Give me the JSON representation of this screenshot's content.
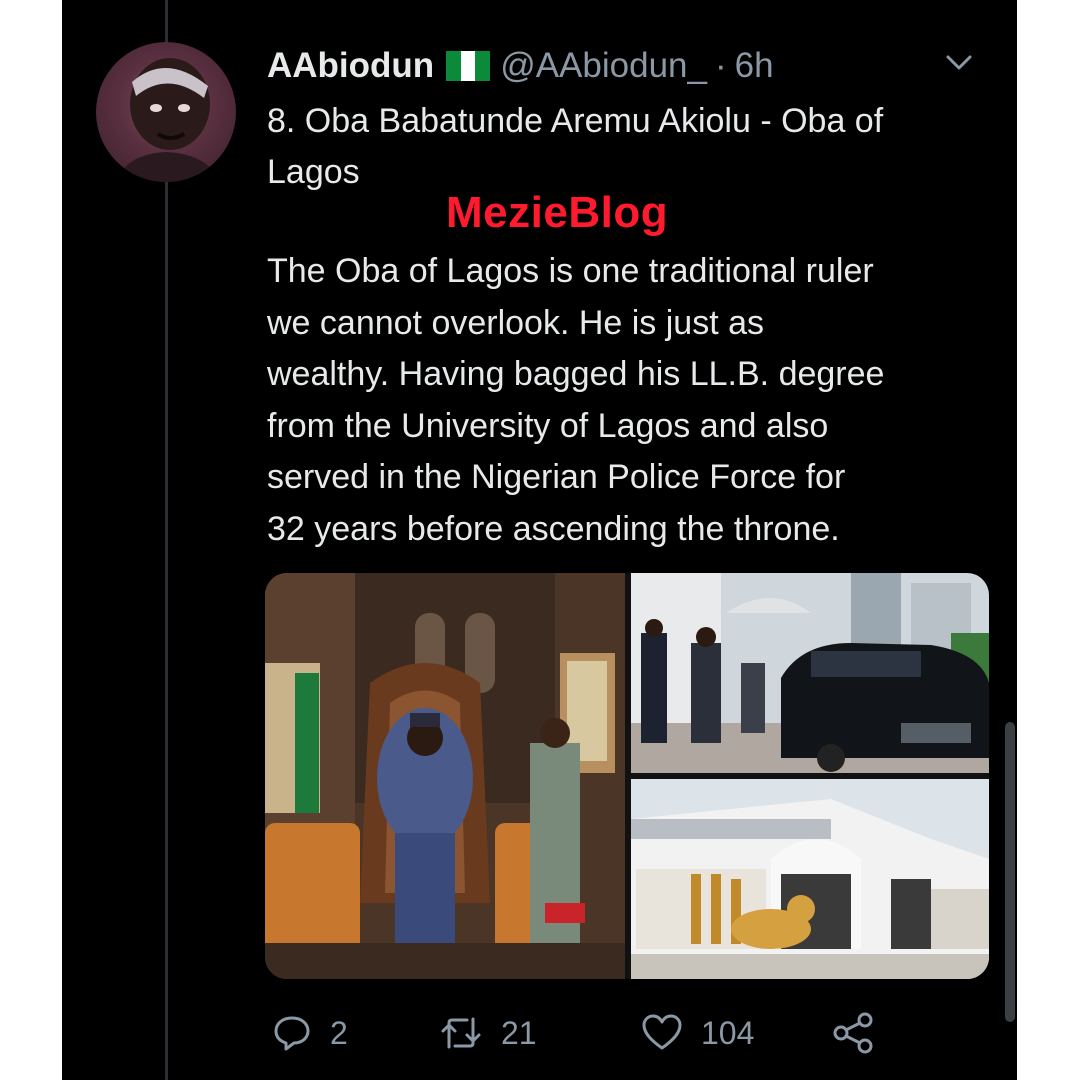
{
  "tweet": {
    "display_name": "AAbiodun",
    "flag_icon": "nigeria-flag-icon",
    "handle": "@AAbiodun_",
    "separator": "·",
    "timestamp": "6h",
    "title_line1": "8. Oba Babatunde Aremu Akiolu - Oba of",
    "title_line2": "Lagos",
    "watermark": "MezieBlog",
    "body_lines": [
      "The Oba of Lagos is one traditional ruler",
      "we cannot overlook. He is just as",
      "wealthy. Having bagged his LL.B. degree",
      "from the University of Lagos and also",
      "served in the Nigerian Police Force for",
      "32 years before ascending the throne."
    ]
  },
  "actions": {
    "reply_count": "2",
    "retweet_count": "21",
    "like_count": "104"
  },
  "colors": {
    "background": "#000000",
    "text": "#e7e9ea",
    "secondary": "#8b98a5",
    "watermark": "#ff1a2e"
  }
}
